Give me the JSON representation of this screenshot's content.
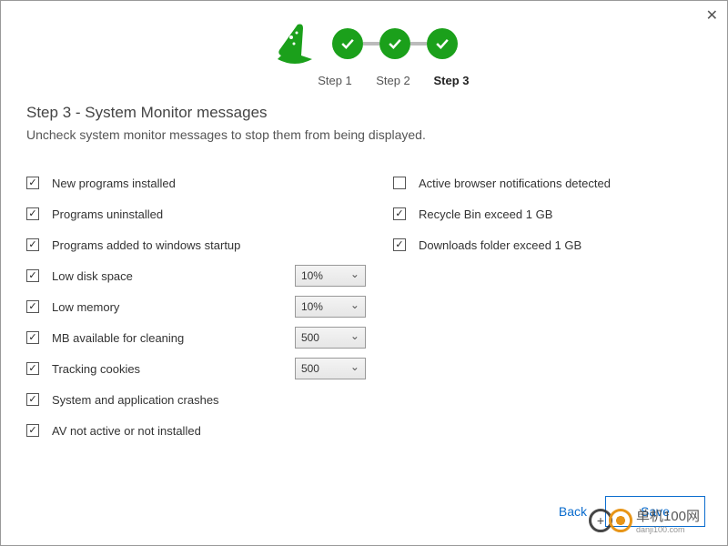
{
  "steps": {
    "s1": "Step 1",
    "s2": "Step 2",
    "s3": "Step 3"
  },
  "title": "Step 3 - System Monitor messages",
  "subtitle": "Uncheck system monitor messages to stop them from being displayed.",
  "left": {
    "r1": "New programs installed",
    "r2": "Programs uninstalled",
    "r3": "Programs added to windows startup",
    "r4": "Low disk space",
    "r5": "Low memory",
    "r6": "MB available for cleaning",
    "r7": "Tracking cookies",
    "r8": "System and application crashes",
    "r9": "AV not active or not installed"
  },
  "right": {
    "r1": "Active browser notifications detected",
    "r2": "Recycle Bin exceed 1 GB",
    "r3": "Downloads folder exceed 1 GB"
  },
  "dropdowns": {
    "d1": "10%",
    "d2": "10%",
    "d3": "500",
    "d4": "500"
  },
  "buttons": {
    "back": "Back",
    "save": "Save"
  },
  "watermark": {
    "text": "单机100网",
    "sub": "danji100.com"
  }
}
